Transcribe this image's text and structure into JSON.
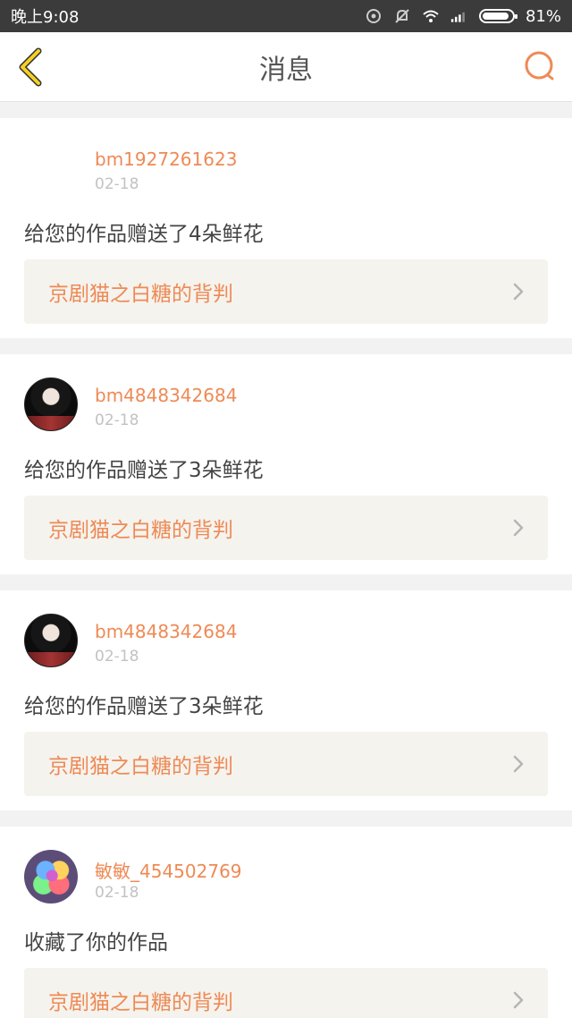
{
  "status_bar": {
    "time": "晚上9:08",
    "battery": "81%"
  },
  "header": {
    "title": "消息",
    "back_icon": "chevron-left-icon",
    "search_icon": "search-icon"
  },
  "colors": {
    "accent": "#ee8a55",
    "back": "#e8c020",
    "text": "#444444",
    "muted": "#c2c2c2"
  },
  "messages": [
    {
      "username": "bm1927261623",
      "date": "02-18",
      "text": "给您的作品赠送了4朵鲜花",
      "work": "京剧猫之白糖的背判",
      "avatar": "blank"
    },
    {
      "username": "bm4848342684",
      "date": "02-18",
      "text": "给您的作品赠送了3朵鲜花",
      "work": "京剧猫之白糖的背判",
      "avatar": "girl"
    },
    {
      "username": "bm4848342684",
      "date": "02-18",
      "text": "给您的作品赠送了3朵鲜花",
      "work": "京剧猫之白糖的背判",
      "avatar": "girl"
    },
    {
      "username": "敏敏_454502769",
      "date": "02-18",
      "text": "收藏了你的作品",
      "work": "京剧猫之白糖的背判",
      "avatar": "rose"
    }
  ]
}
